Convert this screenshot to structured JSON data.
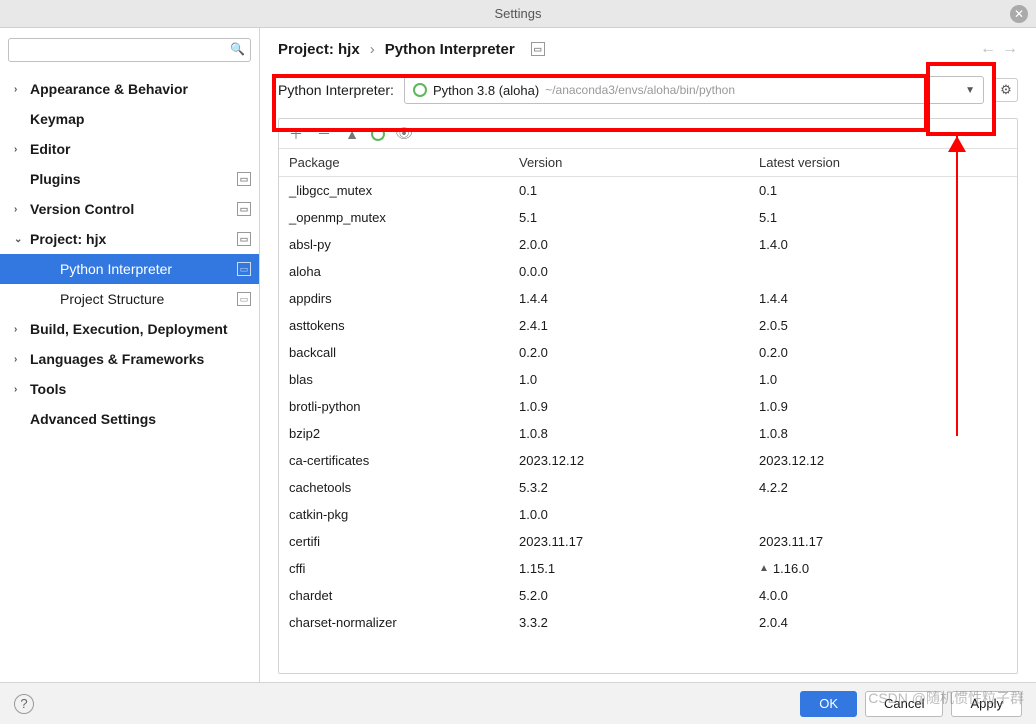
{
  "window": {
    "title": "Settings"
  },
  "search": {
    "placeholder": ""
  },
  "sidebar": {
    "items": [
      {
        "label": "Appearance & Behavior",
        "chev": "›",
        "bold": true
      },
      {
        "label": "Keymap",
        "chev": "",
        "bold": true
      },
      {
        "label": "Editor",
        "chev": "›",
        "bold": true
      },
      {
        "label": "Plugins",
        "chev": "",
        "bold": true,
        "badge": true
      },
      {
        "label": "Version Control",
        "chev": "›",
        "bold": true,
        "badge": true
      },
      {
        "label": "Project: hjx",
        "chev": "⌄",
        "bold": true,
        "badge": true
      },
      {
        "label": "Python Interpreter",
        "chev": "",
        "indent": 2,
        "selected": true,
        "badge": true
      },
      {
        "label": "Project Structure",
        "chev": "",
        "indent": 2,
        "badge": true
      },
      {
        "label": "Build, Execution, Deployment",
        "chev": "›",
        "bold": true
      },
      {
        "label": "Languages & Frameworks",
        "chev": "›",
        "bold": true
      },
      {
        "label": "Tools",
        "chev": "›",
        "bold": true
      },
      {
        "label": "Advanced Settings",
        "chev": "",
        "bold": true
      }
    ]
  },
  "breadcrumb": {
    "seg1": "Project: hjx",
    "sep": "›",
    "seg2": "Python Interpreter"
  },
  "interpreter": {
    "label": "Python Interpreter:",
    "name": "Python 3.8 (aloha)",
    "path": "~/anaconda3/envs/aloha/bin/python"
  },
  "packages": {
    "headers": {
      "pkg": "Package",
      "ver": "Version",
      "lat": "Latest version"
    },
    "rows": [
      {
        "pkg": "_libgcc_mutex",
        "ver": "0.1",
        "lat": "0.1"
      },
      {
        "pkg": "_openmp_mutex",
        "ver": "5.1",
        "lat": "5.1"
      },
      {
        "pkg": "absl-py",
        "ver": "2.0.0",
        "lat": "1.4.0"
      },
      {
        "pkg": "aloha",
        "ver": "0.0.0",
        "lat": ""
      },
      {
        "pkg": "appdirs",
        "ver": "1.4.4",
        "lat": "1.4.4"
      },
      {
        "pkg": "asttokens",
        "ver": "2.4.1",
        "lat": "2.0.5"
      },
      {
        "pkg": "backcall",
        "ver": "0.2.0",
        "lat": "0.2.0"
      },
      {
        "pkg": "blas",
        "ver": "1.0",
        "lat": "1.0"
      },
      {
        "pkg": "brotli-python",
        "ver": "1.0.9",
        "lat": "1.0.9"
      },
      {
        "pkg": "bzip2",
        "ver": "1.0.8",
        "lat": "1.0.8"
      },
      {
        "pkg": "ca-certificates",
        "ver": "2023.12.12",
        "lat": "2023.12.12"
      },
      {
        "pkg": "cachetools",
        "ver": "5.3.2",
        "lat": "4.2.2"
      },
      {
        "pkg": "catkin-pkg",
        "ver": "1.0.0",
        "lat": ""
      },
      {
        "pkg": "certifi",
        "ver": "2023.11.17",
        "lat": "2023.11.17"
      },
      {
        "pkg": "cffi",
        "ver": "1.15.1",
        "lat": "1.16.0",
        "up": true
      },
      {
        "pkg": "chardet",
        "ver": "5.2.0",
        "lat": "4.0.0"
      },
      {
        "pkg": "charset-normalizer",
        "ver": "3.3.2",
        "lat": "2.0.4"
      }
    ]
  },
  "footer": {
    "ok": "OK",
    "cancel": "Cancel",
    "apply": "Apply"
  },
  "watermark": "CSDN @随机惯性粒子群"
}
